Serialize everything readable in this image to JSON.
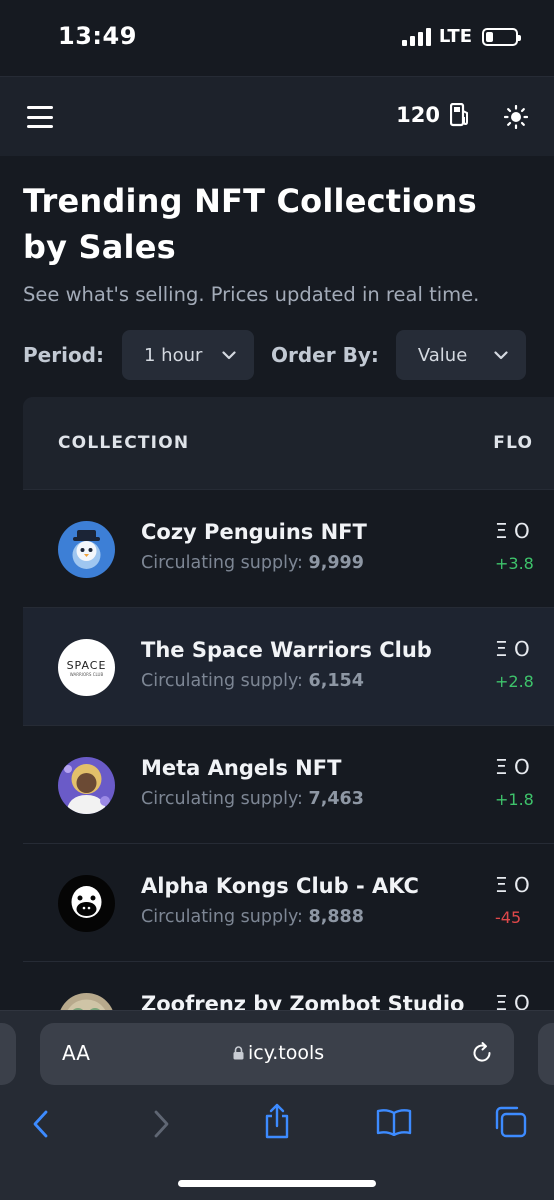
{
  "status_bar": {
    "time": "13:49",
    "network": "LTE",
    "battery_level": 0.2
  },
  "header": {
    "gas_value": "120",
    "menu_icon": "hamburger-menu-icon",
    "gas_icon": "gas-pump-icon",
    "theme_icon": "sun-icon"
  },
  "page": {
    "title": "Trending NFT Collections by Sales",
    "subtitle": "See what's selling. Prices updated in real time.",
    "period_label": "Period:",
    "period_value": "1 hour",
    "order_label": "Order By:",
    "order_value": "Value"
  },
  "table": {
    "columns": [
      "COLLECTION",
      "FLO"
    ],
    "rows": [
      {
        "name": "Cozy Penguins NFT",
        "supply_label": "Circulating supply:",
        "supply": "9,999",
        "floor": "Ξ O",
        "change": "+3.8",
        "direction": "up"
      },
      {
        "name": "The Space Warriors Club",
        "supply_label": "Circulating supply:",
        "supply": "6,154",
        "floor": "Ξ O",
        "change": "+2.8",
        "direction": "up",
        "logo_text": "SPACE",
        "logo_subtext": "WARRIORS CLUB"
      },
      {
        "name": "Meta Angels NFT",
        "supply_label": "Circulating supply:",
        "supply": "7,463",
        "floor": "Ξ O",
        "change": "+1.8",
        "direction": "up"
      },
      {
        "name": "Alpha Kongs Club - AKC",
        "supply_label": "Circulating supply:",
        "supply": "8,888",
        "floor": "Ξ O",
        "change": "-45",
        "direction": "down"
      },
      {
        "name": "Zoofrenz by Zombot Studio",
        "supply_label": "",
        "supply": "",
        "floor": "Ξ O",
        "change": "",
        "direction": ""
      }
    ]
  },
  "browser": {
    "aa_label": "AA",
    "url": "icy.tools"
  },
  "colors": {
    "background": "#161a21",
    "positive": "#3ec36b",
    "negative": "#e0484a",
    "accent_blue": "#3d8bff"
  }
}
